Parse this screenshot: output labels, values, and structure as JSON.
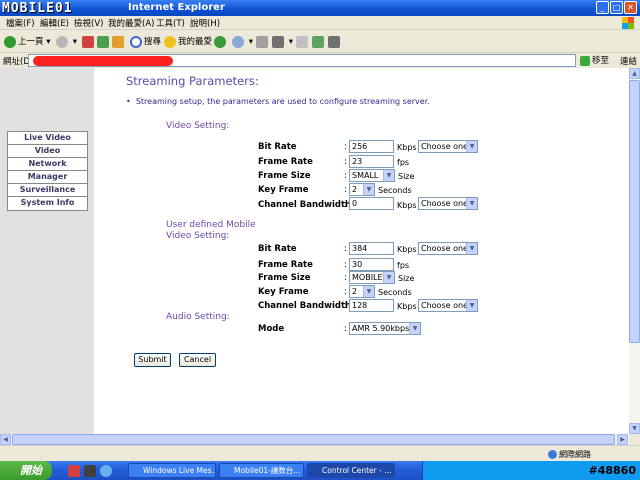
{
  "window": {
    "logo": "MOBILE01",
    "title": "Internet Explorer"
  },
  "menu": [
    "檔案(F)",
    "編輯(E)",
    "檢視(V)",
    "我的最愛(A)",
    "工具(T)",
    "說明(H)"
  ],
  "toolbar": {
    "back": "上一頁",
    "search": "搜尋",
    "favorites": "我的最愛"
  },
  "address": {
    "label": "網址(D)",
    "go": "移至",
    "links": "連結"
  },
  "nav": [
    "Live Video",
    "Video",
    "Network",
    "Manager",
    "Surveillance",
    "System Info"
  ],
  "page": {
    "heading": "Streaming Parameters:",
    "description": "Streaming setup, the parameters are used to configure streaming server.",
    "video_section": "Video Setting:",
    "mobile_section_line1": "User defined Mobile",
    "mobile_section_line2": "Video Setting:",
    "audio_section": "Audio Setting:"
  },
  "video": {
    "bit_rate_label": "Bit Rate",
    "bit_rate": "256",
    "bit_rate_unit": "Kbps",
    "bit_rate_choice": "Choose one",
    "frame_rate_label": "Frame Rate",
    "frame_rate": "23",
    "frame_rate_unit": "fps",
    "frame_size_label": "Frame Size",
    "frame_size": "SMALL",
    "frame_size_unit": "Size",
    "key_frame_label": "Key Frame",
    "key_frame": "2",
    "key_frame_unit": "Seconds",
    "bandwidth_label": "Channel Bandwidth",
    "bandwidth": "0",
    "bandwidth_unit": "Kbps",
    "bandwidth_choice": "Choose one"
  },
  "mobile": {
    "bit_rate_label": "Bit Rate",
    "bit_rate": "384",
    "bit_rate_unit": "Kbps",
    "bit_rate_choice": "Choose one",
    "frame_rate_label": "Frame Rate",
    "frame_rate": "30",
    "frame_rate_unit": "fps",
    "frame_size_label": "Frame Size",
    "frame_size": "MOBILE",
    "frame_size_unit": "Size",
    "key_frame_label": "Key Frame",
    "key_frame": "2",
    "key_frame_unit": "Seconds",
    "bandwidth_label": "Channel Bandwidth",
    "bandwidth": "128",
    "bandwidth_unit": "Kbps",
    "bandwidth_choice": "Choose one"
  },
  "audio": {
    "mode_label": "Mode",
    "mode": "AMR 5.90kbps"
  },
  "buttons": {
    "submit": "Submit",
    "cancel": "Cancel"
  },
  "statusbar": {
    "zone": "網際網路"
  },
  "taskbar": {
    "start": "開始",
    "tasks": [
      "Windows Live Mes...",
      "Mobile01-讓数台...",
      "Control Center - ..."
    ],
    "watermark": "#48860"
  }
}
